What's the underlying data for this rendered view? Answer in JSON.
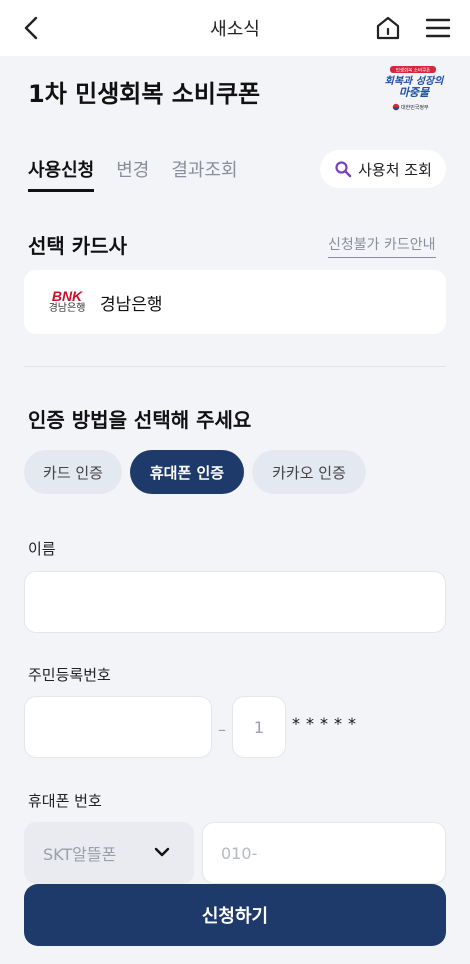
{
  "header": {
    "title": "새소식",
    "back_icon": "chevron-left-icon",
    "home_icon": "home-icon",
    "menu_icon": "hamburger-menu-icon"
  },
  "page": {
    "title": "1차 민생회복 소비쿠폰",
    "logo": {
      "tag": "민생회복 소비쿠폰",
      "line1": "회복과 성장의",
      "line2": "마중물",
      "org": "대한민국정부"
    }
  },
  "tabs": [
    {
      "label": "사용신청",
      "active": true
    },
    {
      "label": "변경",
      "active": false
    },
    {
      "label": "결과조회",
      "active": false
    }
  ],
  "search": {
    "label": "사용처 조회",
    "icon": "search-icon"
  },
  "card_section": {
    "title": "선택 카드사",
    "guide_link": "신청불가 카드안내",
    "selected_bank": {
      "logo_text": "BNK",
      "logo_sub": "경남은행",
      "name": "경남은행"
    }
  },
  "auth_section": {
    "title": "인증 방법을 선택해 주세요",
    "methods": [
      {
        "label": "카드 인증",
        "active": false
      },
      {
        "label": "휴대폰 인증",
        "active": true
      },
      {
        "label": "카카오 인증",
        "active": false
      }
    ]
  },
  "form": {
    "name": {
      "label": "이름",
      "value": ""
    },
    "rrn": {
      "label": "주민등록번호",
      "front_value": "",
      "back_digit": "1",
      "masked": "*****"
    },
    "phone": {
      "label": "휴대폰 번호",
      "carrier": "SKT알뜰폰",
      "placeholder": "010-"
    }
  },
  "submit_label": "신청하기",
  "colors": {
    "primary": "#1e3a6b",
    "background": "#f3f4f8",
    "chip_inactive": "#e4e8f1",
    "bnk_red": "#c8102e"
  }
}
